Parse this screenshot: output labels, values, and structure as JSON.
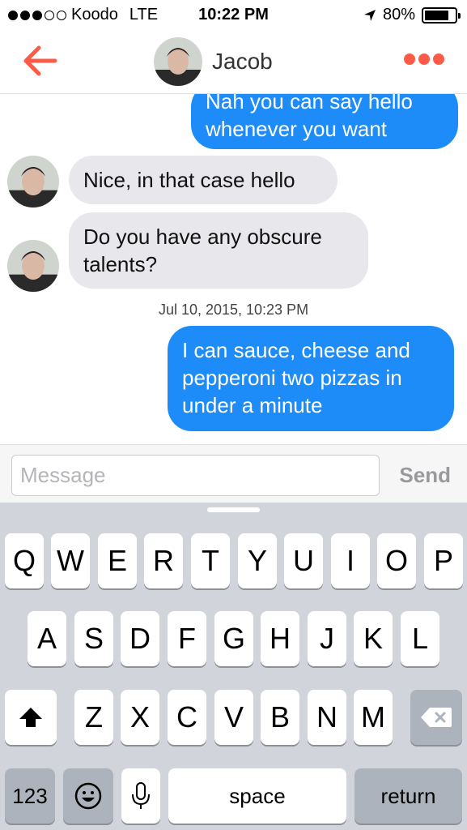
{
  "status_bar": {
    "carrier": "Koodo",
    "network": "LTE",
    "time": "10:22 PM",
    "battery": "80%",
    "battery_level": 0.8
  },
  "nav": {
    "title": "Jacob"
  },
  "messages": [
    {
      "direction": "out",
      "lines": [
        "Nah you can say hello",
        "whenever you want"
      ]
    },
    {
      "direction": "in",
      "lines": [
        "Nice, in that case hello"
      ]
    },
    {
      "direction": "in",
      "lines": [
        "Do you have any obscure",
        "talents?"
      ]
    },
    {
      "direction": "out",
      "lines": [
        "I can sauce, cheese and",
        "pepperoni two pizzas in",
        "under a minute"
      ]
    }
  ],
  "timestamp": "Jul 10, 2015, 10:23 PM",
  "input": {
    "placeholder": "Message",
    "send_label": "Send"
  },
  "keyboard": {
    "row1": [
      "Q",
      "W",
      "E",
      "R",
      "T",
      "Y",
      "U",
      "I",
      "O",
      "P"
    ],
    "row2": [
      "A",
      "S",
      "D",
      "F",
      "G",
      "H",
      "J",
      "K",
      "L"
    ],
    "row3": [
      "Z",
      "X",
      "C",
      "V",
      "B",
      "N",
      "M"
    ],
    "numbers": "123",
    "space": "space",
    "return": "return"
  },
  "colors": {
    "accent": "#fd5b48",
    "outgoing_bubble": "#1e8cf8",
    "incoming_bubble": "#e7e7ec"
  },
  "icons": {
    "back": "arrow-left-icon",
    "more": "more-dots-icon",
    "shift": "shift-arrow-icon",
    "delete": "backspace-icon",
    "emoji": "emoji-face-icon",
    "mic": "microphone-icon"
  }
}
